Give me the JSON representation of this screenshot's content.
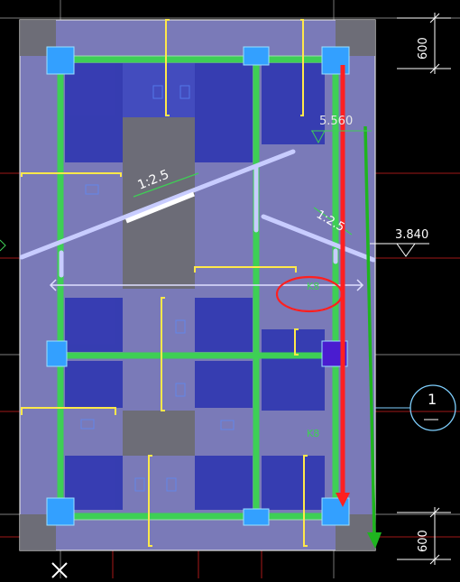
{
  "labels": {
    "dim_top": "600",
    "dim_bottom": "600",
    "elev_top": "5.560",
    "elev_mid": "3.840",
    "slope_left": "1:2.5",
    "slope_right": "1:2.5",
    "beam_k8_a": "K8",
    "beam_k8_b": "K8",
    "section_num": "1"
  },
  "colors": {
    "background": "#000000",
    "slab_overlay": "#7a7ab8",
    "slab_dark": "#2b33b0",
    "column": "#33a0ff",
    "beam_green": "#3ecf55",
    "rebar_yellow": "#ffe84a",
    "highlight_red": "#ff2020",
    "arrow_green": "#1fb51f",
    "roof_line": "#c8ccff",
    "axis_cyan": "#7fd0ff"
  },
  "icons": {
    "close": "close-icon",
    "section_symbol": "section-symbol-icon",
    "elevation": "elevation-marker-icon"
  }
}
